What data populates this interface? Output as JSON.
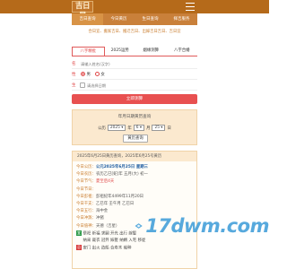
{
  "header": {
    "logo_text": "吉日星"
  },
  "nav": [
    "吉日查询",
    "今日黄历",
    "生日查询",
    "择吉服务"
  ],
  "tags": "合日宜、搬家吉日、搬迁吉日、出嫁吉日吉日、吉日宜",
  "tabs": [
    "八字精批",
    "2025运势",
    "姻缘测算",
    "八字合婚"
  ],
  "form": {
    "name_label": "名",
    "name_placeholder": "请输入姓名(汉字)",
    "gender_label": "性",
    "gender_options": [
      "男",
      "女"
    ],
    "birth_label": "生",
    "birth_placeholder": "请选择日期"
  },
  "submit_label": "立即测算",
  "query": {
    "title": "年月日期黄历查询",
    "prefix": "公历",
    "year": "2025",
    "year_unit": "年",
    "month": "6",
    "month_unit": "月",
    "day": "25",
    "day_unit": "日",
    "button": "黄历查询"
  },
  "almanac": {
    "header": "2025年6月25日黄历查询，2025年6月25号黄历",
    "rows": [
      {
        "k": "今日公历：",
        "v": "公元2025年6月25日 星期三",
        "style": "strong"
      },
      {
        "k": "今日农历：",
        "v": "农历乙巳[蛇]年 五月(大) 初一",
        "style": "plain"
      },
      {
        "k": "今日节气：",
        "v": "夏至后4天",
        "style": "red"
      },
      {
        "k": "今日节日：",
        "v": "",
        "style": "plain"
      },
      {
        "k": "今日彭祖：",
        "v": "彭祖纪年4499年11月20日",
        "style": "plain"
      },
      {
        "k": "今日干支：",
        "v": "乙巳年 壬午月 乙巳日",
        "style": "plain"
      },
      {
        "k": "今日五行：",
        "v": "海中金",
        "style": "plain"
      },
      {
        "k": "今日冲煞：",
        "v": "冲猪",
        "style": "plain"
      },
      {
        "k": "今日值神：",
        "v": "天德（吉星）",
        "style": "plain"
      }
    ],
    "yi": {
      "badge": "宜",
      "v": "祭祀 祈福 求嗣 开光 出行 嫁娶"
    },
    "yi2": "纳采 裁衣 冠笄 嫁娶 纳婿 入宅 移徙",
    "ji": {
      "badge": "忌",
      "v": "安门 出火 造船 合寿木 栽种"
    }
  },
  "colors": {
    "brand": "#b56a1a",
    "accent": "#e85050",
    "panel": "#fbe9cf"
  },
  "watermark": "17dwm.com"
}
